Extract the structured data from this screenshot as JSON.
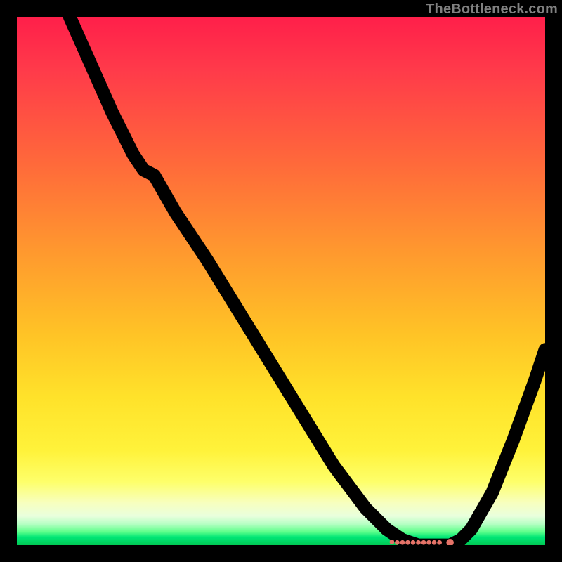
{
  "watermark": "TheBottleneck.com",
  "chart_data": {
    "type": "line",
    "title": "",
    "xlabel": "",
    "ylabel": "",
    "xlim": [
      0,
      100
    ],
    "ylim": [
      0,
      100
    ],
    "grid": false,
    "legend": false,
    "series": [
      {
        "name": "bottleneck-curve",
        "x": [
          10,
          14,
          18,
          22,
          24,
          26,
          30,
          36,
          44,
          52,
          60,
          66,
          70,
          73,
          76,
          78,
          80,
          82,
          84,
          86,
          90,
          94,
          98,
          100
        ],
        "y": [
          100,
          91,
          82,
          74,
          71,
          70,
          63,
          54,
          41,
          28,
          15,
          7,
          3,
          1,
          0,
          0,
          0,
          0,
          1,
          3,
          10,
          20,
          31,
          37
        ]
      }
    ],
    "markers": {
      "name": "optimal-points",
      "x": [
        71,
        72,
        73,
        74,
        75,
        76,
        77,
        78,
        79,
        80,
        82
      ],
      "y": [
        0.6,
        0.5,
        0.5,
        0.5,
        0.5,
        0.5,
        0.5,
        0.5,
        0.5,
        0.5,
        0.5
      ]
    },
    "background_gradient": {
      "top": "#ff1f4a",
      "bottom": "#00c853"
    }
  }
}
